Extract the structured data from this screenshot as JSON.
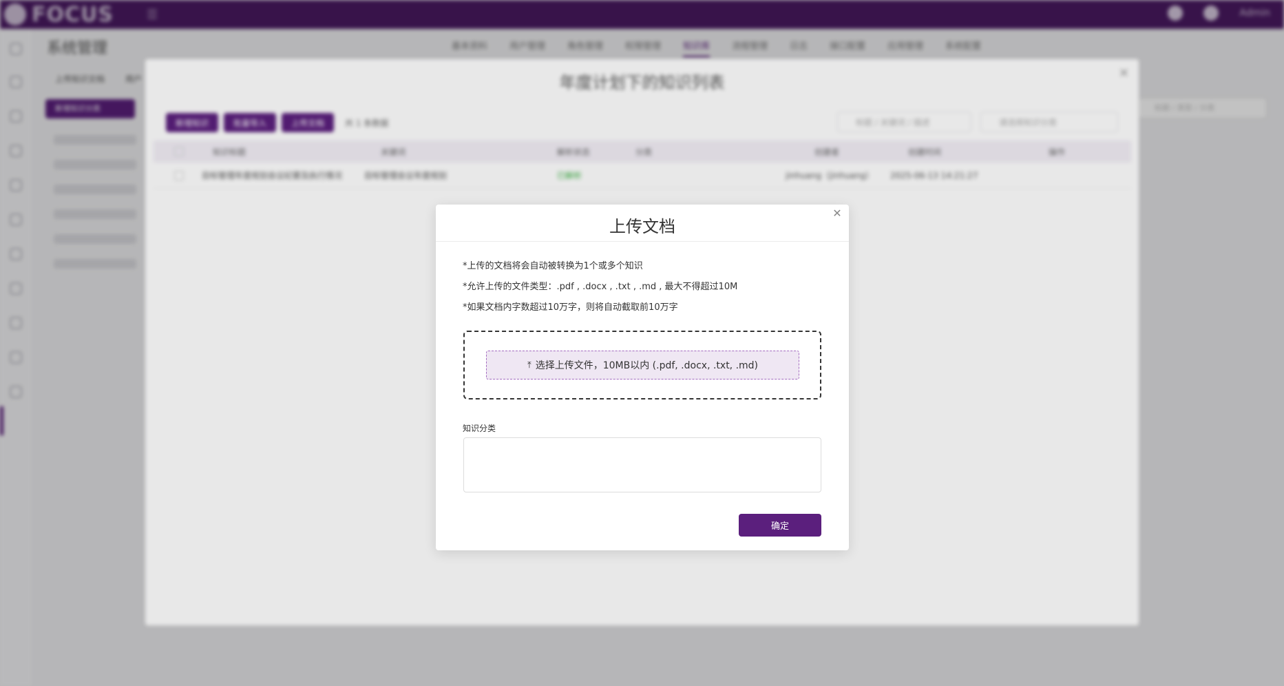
{
  "app": {
    "logo_text": "FOCUS",
    "user_name": "Admin",
    "page_title": "系统管理",
    "tabs": [
      {
        "label": "基本资料",
        "active": false
      },
      {
        "label": "用户管理",
        "active": false
      },
      {
        "label": "角色管理",
        "active": false
      },
      {
        "label": "权限管理",
        "active": false
      },
      {
        "label": "知识库",
        "active": true
      },
      {
        "label": "流程管理",
        "active": false
      },
      {
        "label": "日志",
        "active": false
      },
      {
        "label": "接口配置",
        "active": false
      },
      {
        "label": "应用管理",
        "active": false
      },
      {
        "label": "系统配置",
        "active": false
      }
    ],
    "sub_links": [
      "上传知识文档",
      "用户"
    ],
    "sub_button": "新增知识分类",
    "sub_search_placeholder": "标题 / 类型 / 分类"
  },
  "list_modal": {
    "title": "年度计划下的知识列表",
    "buttons": [
      "新增知识",
      "批量导入",
      "上传文档"
    ],
    "count": "共 1 条数据",
    "search1_placeholder": "标题 / 关键词 / 描述",
    "search2_placeholder": "请选择知识分类",
    "columns": [
      "知识标题",
      "关键词",
      "解析状态",
      "分类",
      "创建者",
      "创建时间",
      "操作"
    ],
    "rows": [
      {
        "title": "目标管理年度规划会议纪要及执行情况",
        "keywords": "目标管理会议年度规划",
        "status": "已解析",
        "category": "",
        "creator": "jinhuang（jinhuang）",
        "created": "2025-06-13 14:21:27",
        "action": ""
      }
    ]
  },
  "upload_dialog": {
    "title": "上传文档",
    "notes": [
      "*上传的文档将会自动被转换为1个或多个知识",
      "*允许上传的文件类型：.pdf , .docx , .txt , .md , 最大不得超过10M",
      "*如果文档内字数超过10万字，则将自动截取前10万字"
    ],
    "choose_file_label": "选择上传文件，10MB以内 (.pdf, .docx, .txt, .md)",
    "category_label": "知识分类",
    "category_value": "",
    "confirm_label": "确定"
  },
  "colors": {
    "brand": "#5b1f7d",
    "topbar": "#4a1a62",
    "upload_zone": "#efe7f3",
    "success": "#3cb043"
  },
  "icons": {
    "close": "close-icon",
    "upload": "upload-icon",
    "bell": "bell-icon",
    "settings": "gear-icon"
  }
}
